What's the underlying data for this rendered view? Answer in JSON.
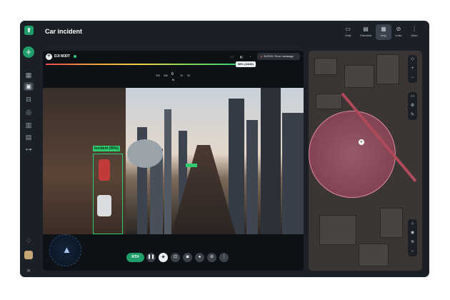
{
  "header": {
    "title": "Car incident"
  },
  "toolbar": [
    {
      "label": "Chat",
      "icon": "chat-icon",
      "glyph": "▭"
    },
    {
      "label": "Checklist",
      "icon": "checklist-icon",
      "glyph": "▤"
    },
    {
      "label": "Map",
      "icon": "map-icon",
      "glyph": "▦"
    },
    {
      "label": "Links",
      "icon": "link-icon",
      "glyph": "⊘"
    },
    {
      "label": "More",
      "icon": "more-icon",
      "glyph": "⋮"
    }
  ],
  "sidebar": {
    "logo": "⬆",
    "add": "+",
    "icons": [
      "dashboard-icon",
      "map-icon",
      "cast-icon",
      "target-icon",
      "building-icon",
      "gallery-icon",
      "org-chart-icon",
      "bell-icon",
      "collapse-icon"
    ]
  },
  "video": {
    "drone_name": "DJI M30T",
    "progress_percent": 58,
    "progress_label": "58% (24/33)",
    "error_text": "312010: Error message",
    "compass": {
      "heading": "0",
      "direction": "N",
      "ticks": [
        "330",
        "345",
        "N",
        "15",
        "30"
      ]
    },
    "detection_label": "Incident (95%)",
    "rth_label": "RTH"
  },
  "colors": {
    "accent": "#1f9d6a",
    "detect": "#2ecc71",
    "error": "#f06464"
  }
}
